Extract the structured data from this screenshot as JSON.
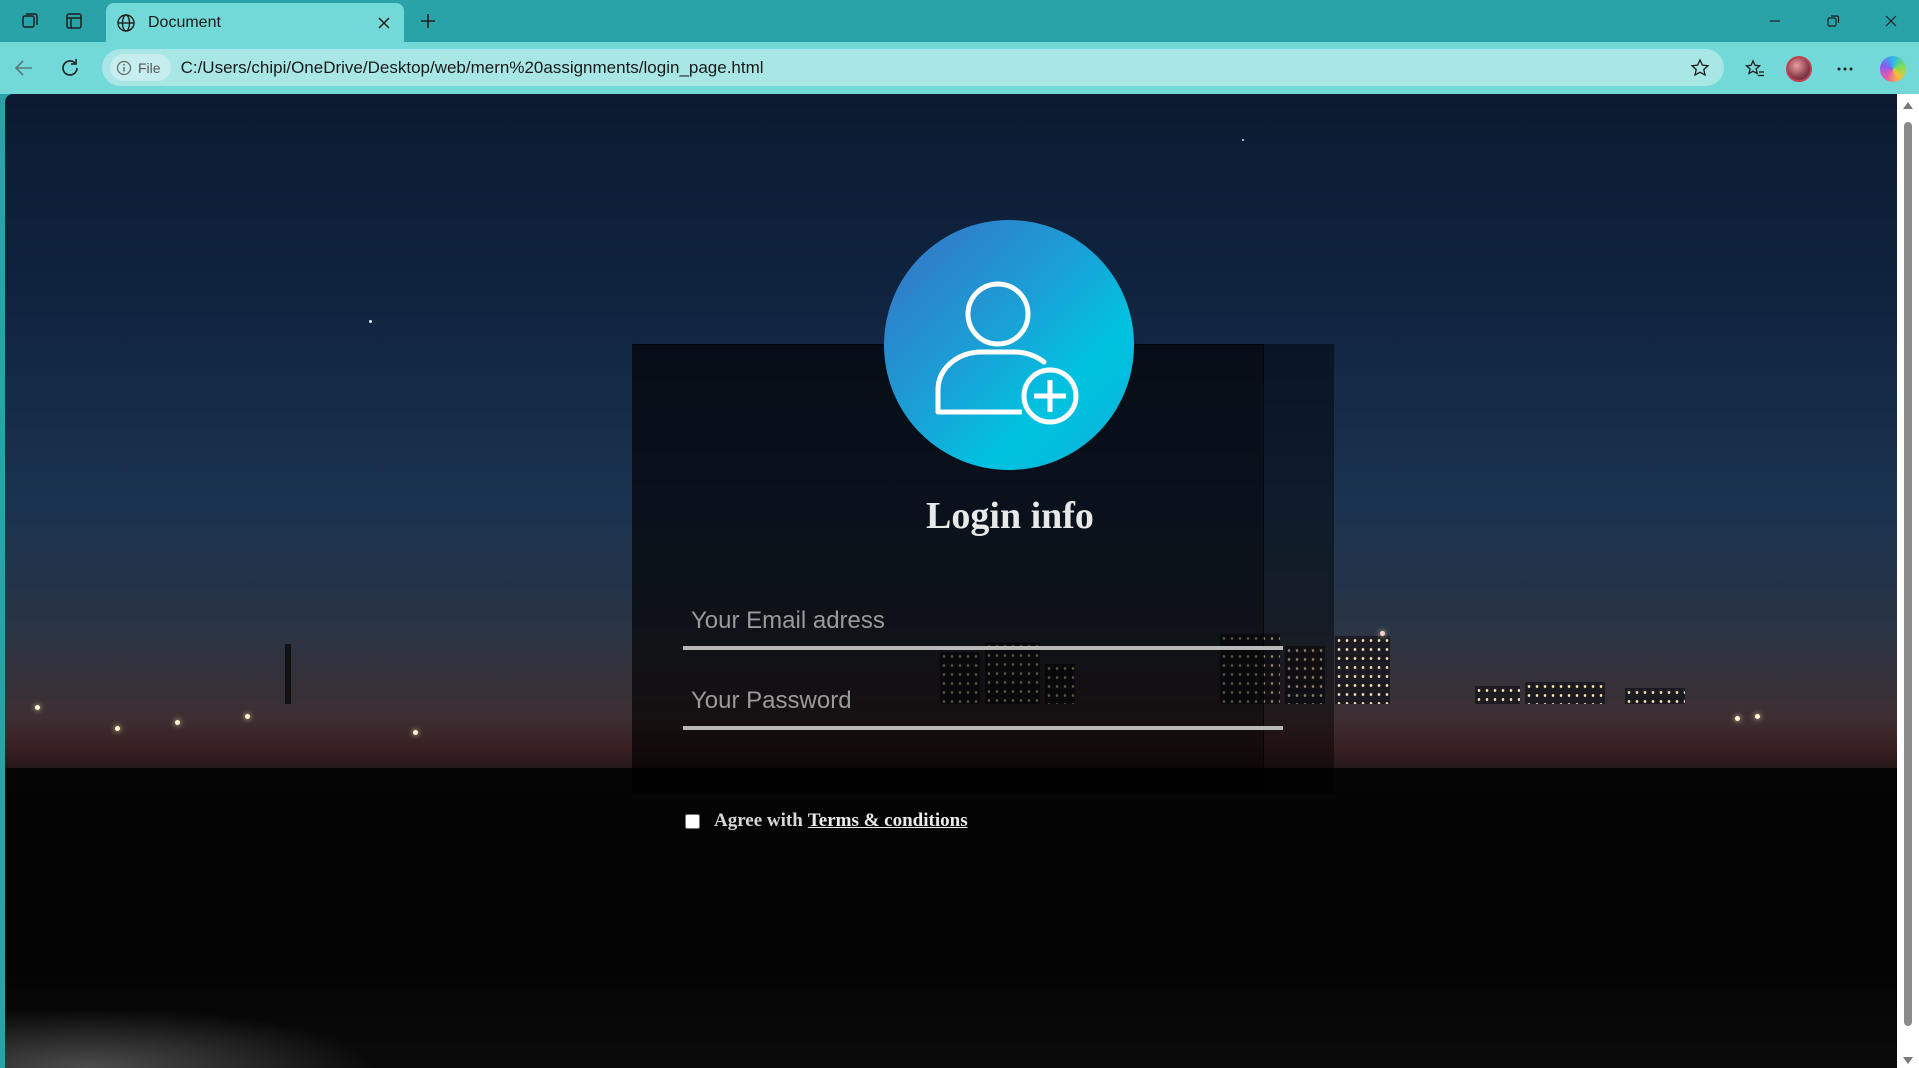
{
  "browser": {
    "tab_title": "Document",
    "address": {
      "scheme_label": "File",
      "url": "C:/Users/chipi/OneDrive/Desktop/web/mern%20assignments/login_page.html"
    }
  },
  "login": {
    "title": "Login info",
    "email_placeholder": "Your Email adress",
    "password_placeholder": "Your Password",
    "agree_text": "Agree with",
    "terms_link": "Terms & conditions",
    "agree_checked": false
  },
  "colors": {
    "accent": "#00c3e0",
    "chrome": "#2aa3a8",
    "toolbar": "#72d8d8"
  },
  "icons": [
    "workspaces-icon",
    "tab-actions-icon",
    "globe-icon",
    "close-icon",
    "plus-icon",
    "minimize-icon",
    "restore-icon",
    "back-icon",
    "refresh-icon",
    "info-icon",
    "favorite-star-icon",
    "favorites-icon",
    "more-icon",
    "copilot-icon",
    "user-add-icon"
  ]
}
